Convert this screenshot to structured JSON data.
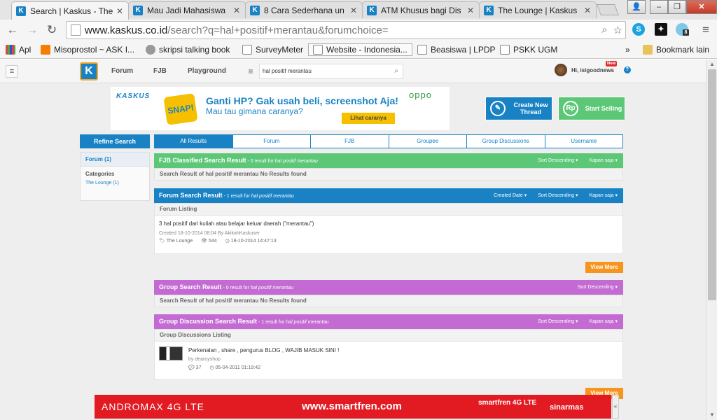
{
  "browser": {
    "tabs": [
      {
        "title": "Search | Kaskus - The"
      },
      {
        "title": "Mau Jadi Mahasiswa"
      },
      {
        "title": "8 Cara Sederhana un"
      },
      {
        "title": "ATM Khusus bagi Dis"
      },
      {
        "title": "The Lounge | Kaskus"
      }
    ],
    "url_host": "www.kaskus.co.id",
    "url_path": "/search?q=hal+positif+merantau&forumchoice=",
    "bookmarks": [
      {
        "label": "Apl"
      },
      {
        "label": "Misoprostol ~ ASK I..."
      },
      {
        "label": "skripsi talking book"
      },
      {
        "label": "SurveyMeter"
      },
      {
        "label": "Website - Indonesia..."
      },
      {
        "label": "Beasiswa | LPDP"
      },
      {
        "label": "PSKK UGM"
      }
    ],
    "bookmarks_overflow": "»",
    "other_bookmarks": "Bookmark lain",
    "ext_badge": "8"
  },
  "header": {
    "logo": "K",
    "nav": [
      "Forum",
      "FJB",
      "Playground"
    ],
    "search_value": "hal positif merantau",
    "username": "Hi, isigoodnews",
    "new_badge": "New"
  },
  "banner": {
    "brand": "KASKUS",
    "snap": "SNAP!",
    "headline": "Ganti HP? Gak usah beli, screenshot Aja!",
    "subline": "Mau tau gimana caranya?",
    "cta": "Lihat caranya",
    "partner": "oppo"
  },
  "actions": {
    "create_thread": [
      "Create New",
      "Thread"
    ],
    "start_selling": "Start Selling"
  },
  "refine": {
    "title": "Refine Search",
    "selected": "Forum (1)",
    "categories_label": "Categories",
    "category": "The Lounge (1)"
  },
  "result_tabs": [
    "All Results",
    "Forum",
    "FJB",
    "Groupee",
    "Group Discussions",
    "Username"
  ],
  "sections": {
    "fjb": {
      "title": "FJB Classified Search Result",
      "count": " - 0 result for ",
      "query": "hal positif merantau",
      "sort": "Sort Descending",
      "time": "Kapan saja",
      "sub": "Search Result of hal positif merantau No Results found"
    },
    "forum": {
      "title": "Forum Search Result",
      "count": " - 1 result for ",
      "query": "hal positif merantau",
      "created": "Created Date",
      "sort": "Sort Descending",
      "time": "Kapan saja",
      "sub": "Forum Listing",
      "item_title": "3 hal positif dari kuliah atau belajar keluar daerah (\"merantau\")",
      "item_meta": "Created 18-10-2014 08:04 By AkikahKaskuser",
      "item_forum": "The Lounge",
      "item_views": "544",
      "item_last": "18-10-2014 14:47:13",
      "view_more": "View More"
    },
    "group": {
      "title": "Group Search Result",
      "count": " - 0 result for ",
      "query": "hal positif merantau",
      "sort": "Sort Descending",
      "sub": "Search Result of hal positif merantau No Results found"
    },
    "discussion": {
      "title": "Group Discussion Search Result",
      "count": " - 1 result for ",
      "query": "hal positif merantau",
      "sort": "Sort Descending",
      "time": "Kapan saja",
      "sub": "Group Discussions Listing",
      "item_title": "Perkenalan , share , pengurus BLOG , WAJIB MASUK SINI !",
      "item_meta": "by dearoyshop",
      "item_replies": "37",
      "item_date": "05-04-2011 01:19:42",
      "view_more": "View More"
    }
  },
  "bottom_ad": {
    "brand": "ANDROMAX 4G LTE",
    "url": "www.smartfren.com",
    "sponsor": "smartfren 4G LTE",
    "partner": "sinarmas"
  },
  "colors": {
    "kaskus_blue": "#1982c4",
    "fjb_green": "#5cc777",
    "group_purple": "#c36bd3",
    "view_more_orange": "#f7941d",
    "ad_red": "#e21a22"
  }
}
